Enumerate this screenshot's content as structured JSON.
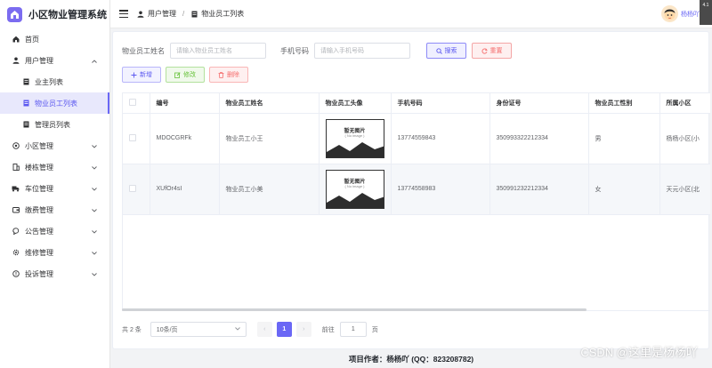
{
  "app": {
    "title": "小区物业管理系统"
  },
  "sidebar": {
    "home": "首页",
    "user_mgmt": "用户管理",
    "user_sub": [
      "业主列表",
      "物业员工列表",
      "管理员列表"
    ],
    "groups": [
      "小区管理",
      "楼栋管理",
      "车位管理",
      "缴费管理",
      "公告管理",
      "维修管理",
      "投诉管理"
    ]
  },
  "header": {
    "breadcrumb": [
      "用户管理",
      "物业员工列表"
    ],
    "user_name": "杨杨吖",
    "corner_badge": "4.1"
  },
  "search": {
    "name_label": "物业员工姓名",
    "name_placeholder": "请输入物业员工姓名",
    "phone_label": "手机号码",
    "phone_placeholder": "请输入手机号码",
    "search_btn": "搜索",
    "reset_btn": "重置"
  },
  "actions": {
    "add": "新增",
    "edit": "修改",
    "delete": "删除"
  },
  "table": {
    "columns": [
      "编号",
      "物业员工姓名",
      "物业员工头像",
      "手机号码",
      "身份证号",
      "物业员工性别",
      "所属小区"
    ],
    "no_image_title": "暂无图片",
    "no_image_sub": "( No image )",
    "rows": [
      {
        "id": "MDOCGRFk",
        "name": "物业员工小王",
        "phone": "13774559843",
        "idcard": "350993322212334",
        "gender": "男",
        "community": "杨杨小区(小"
      },
      {
        "id": "XUfOr4sI",
        "name": "物业员工小美",
        "phone": "13774558983",
        "idcard": "350991232212334",
        "gender": "女",
        "community": "天元小区(北"
      }
    ]
  },
  "pagination": {
    "total": "共 2 条",
    "page_size": "10条/页",
    "current": "1",
    "goto_label": "前往",
    "goto_value": "1",
    "page_unit": "页"
  },
  "footer": {
    "author": "项目作者：杨杨吖 (QQ：823208782)"
  },
  "watermark": "CSDN @这里是杨杨吖",
  "colors": {
    "accent": "#6a67f5",
    "danger": "#f56c6c",
    "success": "#67c23a"
  }
}
